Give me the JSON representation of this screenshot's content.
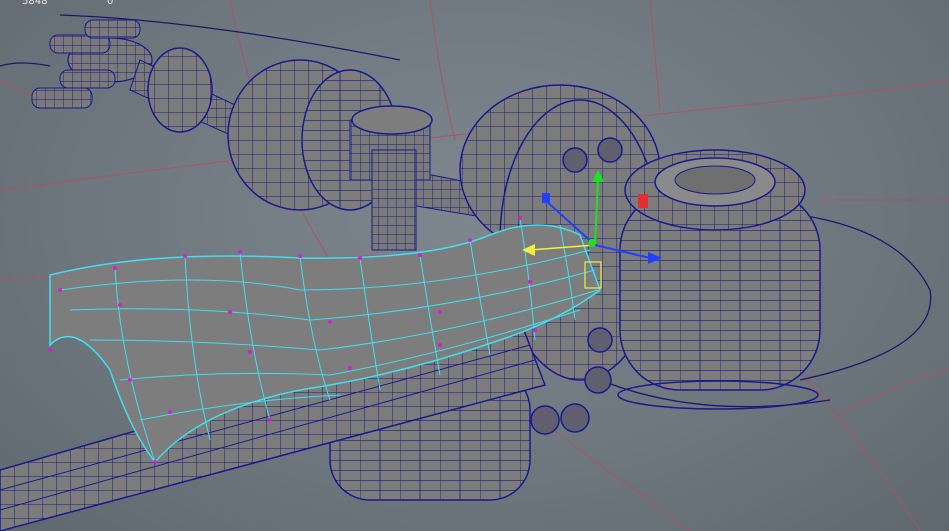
{
  "viewport": {
    "hud": {
      "left_value": "5848",
      "right_value": "0"
    },
    "colors": {
      "background": "#737c84",
      "mesh_fill": "#7a7a7a",
      "wire": "#1a1a8c",
      "selected_wire": "#3fe0f0",
      "vertex": "#d020d0",
      "grid": "#b0506a",
      "axis_x": "#2040ff",
      "axis_y": "#20e020",
      "axis_z": "#e03030",
      "manip_yellow": "#f0f040"
    }
  }
}
